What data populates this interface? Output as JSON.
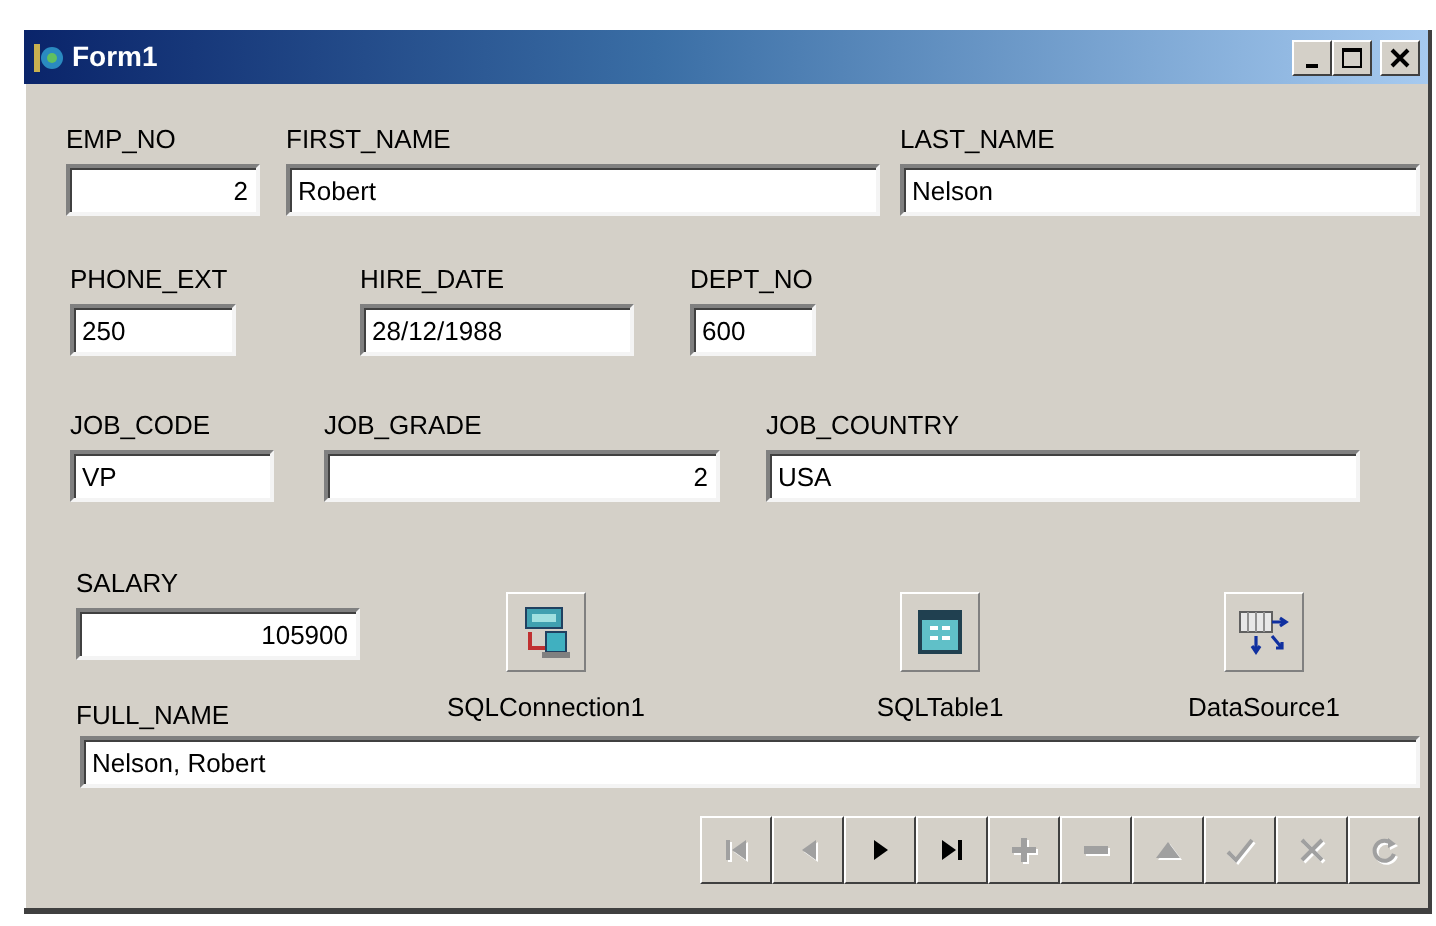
{
  "window": {
    "title": "Form1"
  },
  "field_rows": [
    [
      {
        "label": "EMP_NO",
        "value": "2",
        "right_aligned": true
      },
      {
        "label": "FIRST_NAME",
        "value": "Robert",
        "right_aligned": false
      },
      {
        "label": "LAST_NAME",
        "value": "Nelson",
        "right_aligned": false
      }
    ],
    [
      {
        "label": "PHONE_EXT",
        "value": "250",
        "right_aligned": false
      },
      {
        "label": "HIRE_DATE",
        "value": "28/12/1988",
        "right_aligned": false
      },
      {
        "label": "DEPT_NO",
        "value": "600",
        "right_aligned": false
      }
    ],
    [
      {
        "label": "JOB_CODE",
        "value": "VP",
        "right_aligned": false
      },
      {
        "label": "JOB_GRADE",
        "value": "2",
        "right_aligned": true
      },
      {
        "label": "JOB_COUNTRY",
        "value": "USA",
        "right_aligned": false
      }
    ]
  ],
  "salary": {
    "label": "SALARY",
    "value": "105900",
    "right_aligned": true
  },
  "components": [
    {
      "label": "SQLConnection1",
      "kind": "connection"
    },
    {
      "label": "SQLTable1",
      "kind": "table"
    },
    {
      "label": "DataSource1",
      "kind": "datasource"
    }
  ],
  "full_name": {
    "label": "FULL_NAME",
    "value": "Nelson, Robert",
    "right_aligned": false
  },
  "navigator": [
    {
      "kind": "first",
      "enabled": false
    },
    {
      "kind": "prior",
      "enabled": false
    },
    {
      "kind": "next",
      "enabled": true
    },
    {
      "kind": "last",
      "enabled": true
    },
    {
      "kind": "insert",
      "enabled": false
    },
    {
      "kind": "delete",
      "enabled": false
    },
    {
      "kind": "edit",
      "enabled": false
    },
    {
      "kind": "post",
      "enabled": false
    },
    {
      "kind": "cancel",
      "enabled": false
    },
    {
      "kind": "refresh",
      "enabled": false
    }
  ]
}
